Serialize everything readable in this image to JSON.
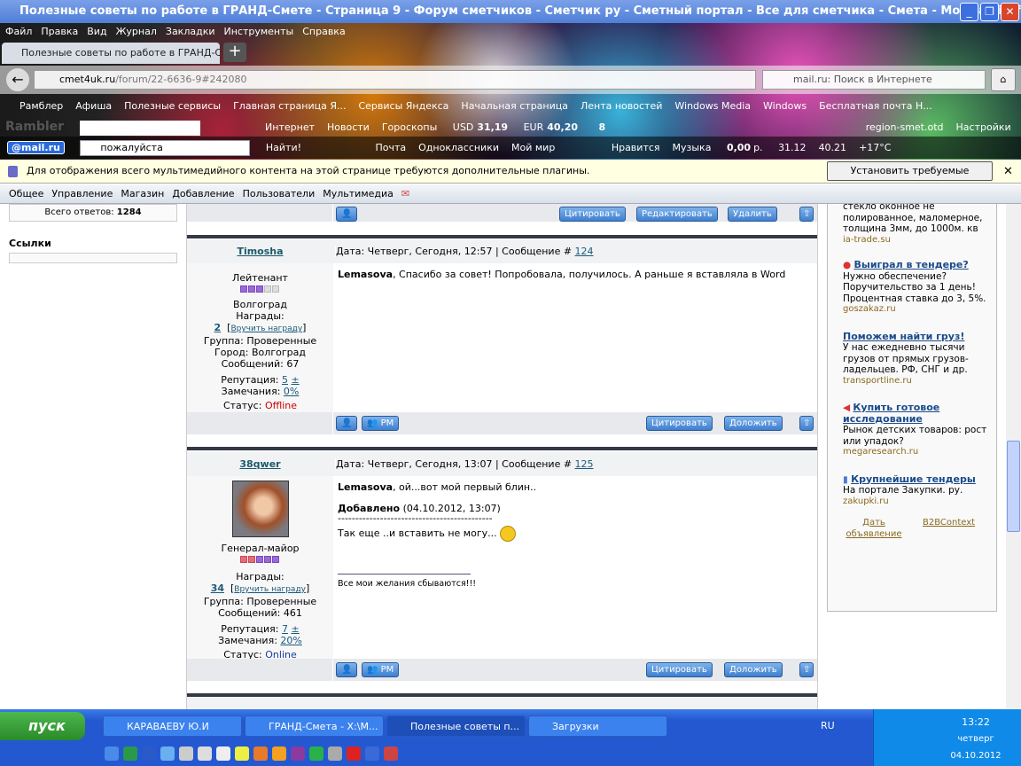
{
  "window": {
    "title": "Полезные советы по работе в ГРАНД-Смете - Страница 9 - Форум сметчиков - Сметчик ру - Сметный портал - Все для сметчика - Смета - Mozilla Firefox"
  },
  "menu": [
    "Файл",
    "Правка",
    "Вид",
    "Журнал",
    "Закладки",
    "Инструменты",
    "Справка"
  ],
  "tab": {
    "label": "Полезные советы по работе в ГРАНД-Сме..."
  },
  "url": {
    "domain": "cmet4uk.ru",
    "path": "/forum/22-6636-9#242080"
  },
  "search": {
    "placeholder": "mail.ru: Поиск в Интернете"
  },
  "bookmarks": [
    "Рамблер",
    "Афиша",
    "Полезные сервисы",
    "Главная страница Я...",
    "Сервисы Яндекса",
    "Начальная страница",
    "Лента новостей",
    "Windows Media",
    "Windows",
    "Бесплатная почта Н..."
  ],
  "rambler": {
    "logo": "Rambler",
    "items": [
      "Интернет",
      "Новости",
      "Гороскопы"
    ],
    "usd_label": "USD",
    "usd": "31,19",
    "eur_label": "EUR",
    "eur": "40,20",
    "mail_count": "8",
    "login": "region-smet.otd",
    "settings": "Настройки"
  },
  "mailru": {
    "logo": "@mail.ru",
    "query": "пожалуйста",
    "find": "Найти!",
    "items": [
      "Почта",
      "Одноклассники",
      "Мой мир",
      "Нравится",
      "Музыка"
    ],
    "balance": "0,00",
    "currency": "р.",
    "usd": "31.12",
    "eur": "40.21",
    "weather": "+17°C"
  },
  "notification": {
    "text": "Для отображения всего мультимедийного контента на этой странице требуются дополнительные плагины.",
    "button": "Установить требуемые плагины..."
  },
  "sitenav": [
    "Общее",
    "Управление",
    "Магазин",
    "Добавление",
    "Пользователи",
    "Мультимедиа"
  ],
  "sidebar": {
    "total_label": "Всего ответов:",
    "total": "1284",
    "links_title": "Ссылки"
  },
  "buttons": {
    "quote": "Цитировать",
    "edit": "Редактировать",
    "delete": "Удалить",
    "report": "Доложить",
    "pm": "PM"
  },
  "posts": [
    {
      "user": "Timosha",
      "date": "Дата: Четверг, Сегодня, 12:57 | Сообщение #",
      "num": "124",
      "rank": "Лейтенант",
      "location": "Волгоград",
      "awards_label": "Награды:",
      "awards": "2",
      "give_award": "Вручить награду",
      "group": "Группа: Проверенные",
      "city": "Город: Волгоград",
      "messages": "Сообщений: 67",
      "rep_label": "Репутация:",
      "rep": "5",
      "rep_pm": "±",
      "warn_label": "Замечания:",
      "warn": "0%",
      "status_label": "Статус:",
      "status": "Offline",
      "quote_to": "Lemasova",
      "text": ", Спасибо за совет! Попробовала, получилось. А раньше я вставляла в Word"
    },
    {
      "user": "38qwer",
      "date": "Дата: Четверг, Сегодня, 13:07 | Сообщение #",
      "num": "125",
      "rank": "Генерал-майор",
      "awards_label": "Награды:",
      "awards": "34",
      "give_award": "Вручить награду",
      "group": "Группа: Проверенные",
      "messages": "Сообщений: 461",
      "rep_label": "Репутация:",
      "rep": "7",
      "rep_pm": "±",
      "warn_label": "Замечания:",
      "warn": "20%",
      "status_label": "Статус:",
      "status": "Online",
      "quote_to": "Lemasova",
      "text": ", ой...вот мой первый блин..",
      "added_label": "Добавлено",
      "added": "(04.10.2012, 13:07)",
      "dashes": "--------------------------------------------",
      "text2": "Так еще ..и вставить не могу...",
      "signature": "Все мои желания сбываются!!!"
    }
  ],
  "ads": [
    {
      "desc": "стекло оконное не полированное, маломерное, толщина 3мм, до 1000м. кв",
      "site": "ia-trade.su"
    },
    {
      "title": "Выиграл в тендере?",
      "desc": "Нужно обеспечение? Поручительство за 1 день! Процентная ставка до 3, 5%.",
      "site": "goszakaz.ru"
    },
    {
      "title": "Поможем найти груз!",
      "desc": "У нас ежедневно тысячи грузов от прямых грузов-ладельцев. РФ, СНГ и др.",
      "site": "transportline.ru"
    },
    {
      "title": "Купить готовое исследование",
      "desc": "Рынок детских товаров: рост или упадок?",
      "site": "megaresearch.ru"
    },
    {
      "title": "Крупнейшие тендеры",
      "desc": "На портале Закупки. ру.",
      "site": "zakupki.ru"
    }
  ],
  "ad_footer": {
    "give": "Дать объявление",
    "brand": "B2BContext"
  },
  "taskbar": {
    "start": "пуск",
    "items": [
      "КАРАВАЕВУ Ю.И",
      "ГРАНД-Смета - X:\\М...",
      "Полезные советы п...",
      "Загрузки"
    ],
    "lang": "RU",
    "time": "13:22",
    "day": "четверг",
    "date": "04.10.2012"
  }
}
